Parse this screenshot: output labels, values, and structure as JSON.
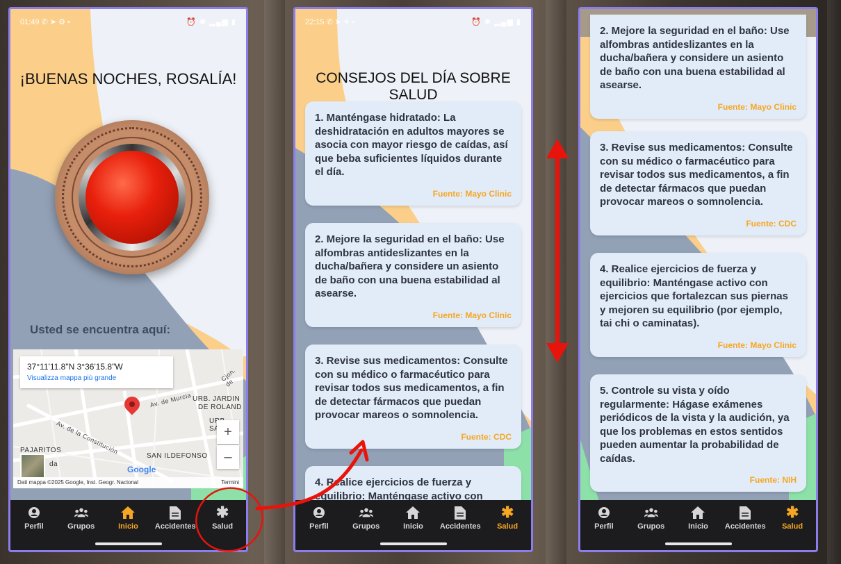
{
  "phones": [
    {
      "status": {
        "time": "01:49",
        "icons": "✆ ➤ ⚙ •",
        "right": "⏰ ✱ ▂▄▆ ▮"
      },
      "greeting": "¡BUENAS NOCHES, ROSALÍA!",
      "location_label": "Usted se encuentra aquí:",
      "map": {
        "coords": "37°11'11.8\"N 3°36'15.8\"W",
        "link": "Visualizza mappa più grande",
        "labels": [
          "Av. de Murcia",
          "URB. JARDIN",
          "DE ROLAND",
          "URB. SAN",
          "Av. de la Constitución",
          "PAJARITOS",
          "SAN ILDEFONSO",
          "Cjon. de",
          "da"
        ],
        "google": "Google",
        "footer_left": "Dati mappa ©2025 Google, Inst. Geogr. Nacional",
        "footer_right": "Termini",
        "zoom_in": "+",
        "zoom_out": "–"
      },
      "nav": [
        "Perfil",
        "Grupos",
        "Inicio",
        "Accidentes",
        "Salud"
      ],
      "active": "Inicio"
    },
    {
      "status": {
        "time": "22:15",
        "icons": "✆ ➤ ✈ •",
        "right": "⏰ ✱ ▂▄▆ ▮"
      },
      "title": "CONSEJOS DEL DÍA SOBRE SALUD",
      "cards": [
        {
          "text": "1. Manténgase hidratado: La deshidratación en adultos mayores se asocia con mayor riesgo de caídas, así que beba suficientes líquidos durante el día.",
          "source": "Fuente: Mayo Clinic"
        },
        {
          "text": "2. Mejore la seguridad en el baño: Use alfombras antideslizantes en la ducha/bañera y considere un asiento de baño con una buena estabilidad al asearse.",
          "source": "Fuente: Mayo Clinic"
        },
        {
          "text": "3. Revise sus medicamentos: Consulte con su médico o farmacéutico para revisar todos sus medicamentos, a fin de detectar fármacos que puedan provocar mareos o somnolencia.",
          "source": "Fuente: CDC"
        },
        {
          "text": "4. Realice ejercicios de fuerza y equilibrio: Manténgase activo con",
          "source": ""
        }
      ],
      "nav": [
        "Perfil",
        "Grupos",
        "Inicio",
        "Accidentes",
        "Salud"
      ],
      "active": "Salud"
    },
    {
      "cards": [
        {
          "text": "2. Mejore la seguridad en el baño: Use alfombras antideslizantes en la ducha/bañera y considere un asiento de baño con una buena estabilidad al asearse.",
          "source": "Fuente: Mayo Clinic"
        },
        {
          "text": "3. Revise sus medicamentos: Consulte con su médico o farmacéutico para revisar todos sus medicamentos, a fin de detectar fármacos que puedan provocar mareos o somnolencia.",
          "source": "Fuente: CDC"
        },
        {
          "text": "4. Realice ejercicios de fuerza y equilibrio: Manténgase activo con ejercicios que fortalezcan sus piernas y mejoren su equilibrio (por ejemplo, tai chi o caminatas).",
          "source": "Fuente: Mayo Clinic"
        },
        {
          "text": "5. Controle su vista y oído regularmente: Hágase exámenes periódicos de la vista y la audición, ya que los problemas en estos sentidos pueden aumentar la probabilidad de caídas.",
          "source": "Fuente: NIH"
        }
      ],
      "nav": [
        "Perfil",
        "Grupos",
        "Inicio",
        "Accidentes",
        "Salud"
      ],
      "active": "Salud"
    }
  ],
  "colors": {
    "accent": "#f5a623",
    "frame": "#8b7dea",
    "annotation": "#e8140c",
    "card": "#e2ecf8",
    "nav_bg": "#1c1c1e"
  },
  "nav_icons": [
    "person-icon",
    "group-icon",
    "home-icon",
    "document-icon",
    "asterisk-icon"
  ]
}
